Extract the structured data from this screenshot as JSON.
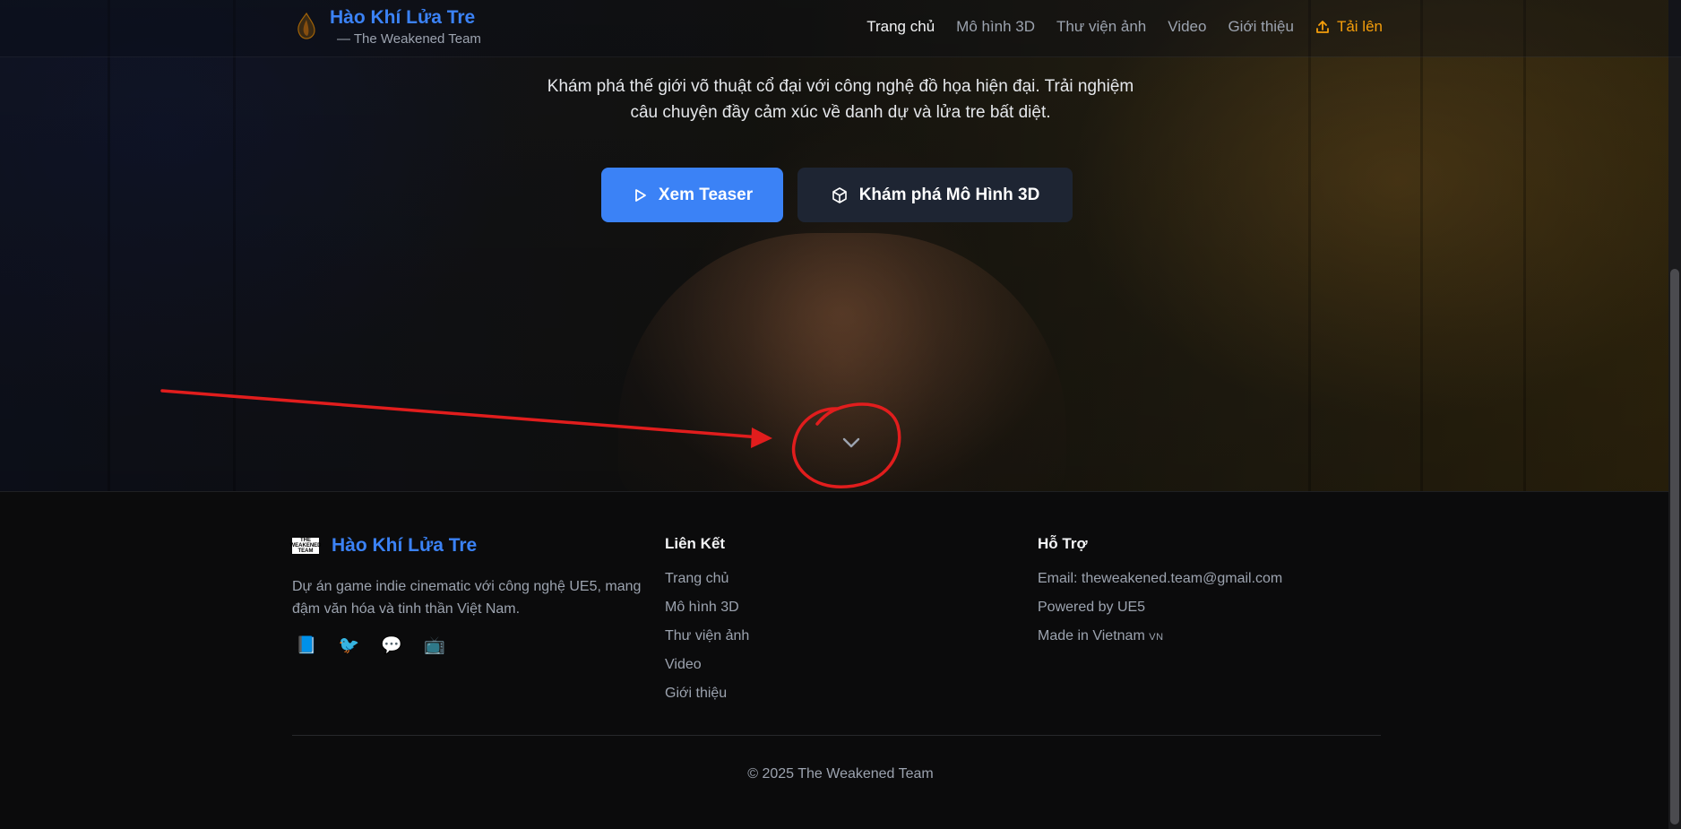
{
  "nav": {
    "brand_title": "Hào Khí Lửa Tre",
    "brand_subtitle": "— The Weakened Team",
    "links": [
      "Trang chủ",
      "Mô hình 3D",
      "Thư viện ảnh",
      "Video",
      "Giới thiệu"
    ],
    "active_index": 0,
    "upload_label": "Tải lên"
  },
  "hero": {
    "description": "Khám phá thế giới võ thuật cổ đại với công nghệ đồ họa hiện đại. Trải nghiệm câu chuyện đầy cảm xúc về danh dự và lửa tre bất diệt.",
    "teaser_button": "Xem Teaser",
    "explore_button": "Khám phá Mô Hình 3D"
  },
  "footer": {
    "logo_text": "THE WEAKENED TEAM",
    "brand_title": "Hào Khí Lửa Tre",
    "description": "Dự án game indie cinematic với công nghệ UE5, mang đậm văn hóa và tinh thần Việt Nam.",
    "socials": [
      "📘",
      "🐦",
      "💬",
      "📺"
    ],
    "links_heading": "Liên Kết",
    "links": [
      "Trang chủ",
      "Mô hình 3D",
      "Thư viện ảnh",
      "Video",
      "Giới thiệu"
    ],
    "support_heading": "Hỗ Trợ",
    "support": {
      "email": "Email: theweakened.team@gmail.com",
      "powered": "Powered by UE5",
      "made_in": "Made in Vietnam",
      "flag": "VN"
    },
    "copyright": "© 2025 The Weakened Team"
  },
  "icons": {
    "logo": "flame-leaf-icon",
    "upload": "upload-icon",
    "play": "play-icon",
    "cube": "cube-icon",
    "scroll": "chevron-down-icon"
  },
  "colors": {
    "accent_blue": "#3b82f6",
    "upload_orange": "#f59e0b",
    "annotation_red": "#e11d1d"
  }
}
